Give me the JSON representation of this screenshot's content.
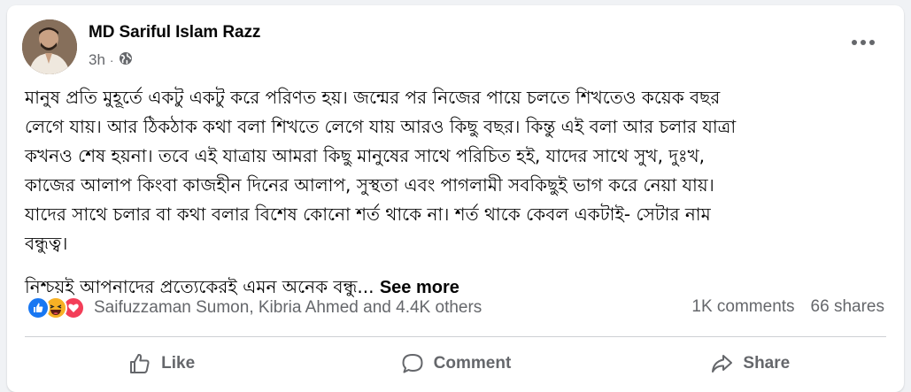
{
  "post": {
    "author": "MD Sariful Islam Razz",
    "time": "3h",
    "dot": "·",
    "paragraph1_lines": [
      "মানুষ প্রতি মুহূর্তে একটু একটু করে পরিণত হয়। জন্মের পর নিজের পায়ে চলতে শিখতেও কয়েক বছর",
      "লেগে যায়। আর ঠিকঠাক কথা বলা শিখতে লেগে যায় আরও কিছু বছর। কিন্তু এই বলা আর চলার যাত্রা",
      "কখনও শেষ হয়না। তবে এই যাত্রায় আমরা কিছু মানুষের সাথে পরিচিত হই, যাদের সাথে সুখ, দুঃখ,",
      "কাজের আলাপ কিংবা কাজহীন দিনের আলাপ, সুস্থতা এবং পাগলামী সবকিছুই ভাগ করে নেয়া যায়।",
      "যাদের সাথে চলার বা কথা বলার বিশেষ কোনো শর্ত থাকে না। শর্ত থাকে কেবল একটাই- সেটার নাম",
      "বন্ধুত্ব।"
    ],
    "paragraph2": "নিশ্চয়ই আপনাদের প্রত্যেকেরই এমন অনেক বন্ধু...",
    "see_more": "See more"
  },
  "engagement": {
    "reaction_icons": [
      "like-reaction-icon",
      "haha-reaction-icon",
      "love-reaction-icon"
    ],
    "reactors": "Saifuzzaman Sumon, Kibria Ahmed and 4.4K others",
    "comments": "1K comments",
    "shares": "66 shares"
  },
  "actions": {
    "like": "Like",
    "comment": "Comment",
    "share": "Share"
  },
  "colors": {
    "like_blue": "#1877f2",
    "love_red": "#f33e58",
    "haha_yellow": "#f7b125",
    "secondary_text": "#65676b"
  }
}
